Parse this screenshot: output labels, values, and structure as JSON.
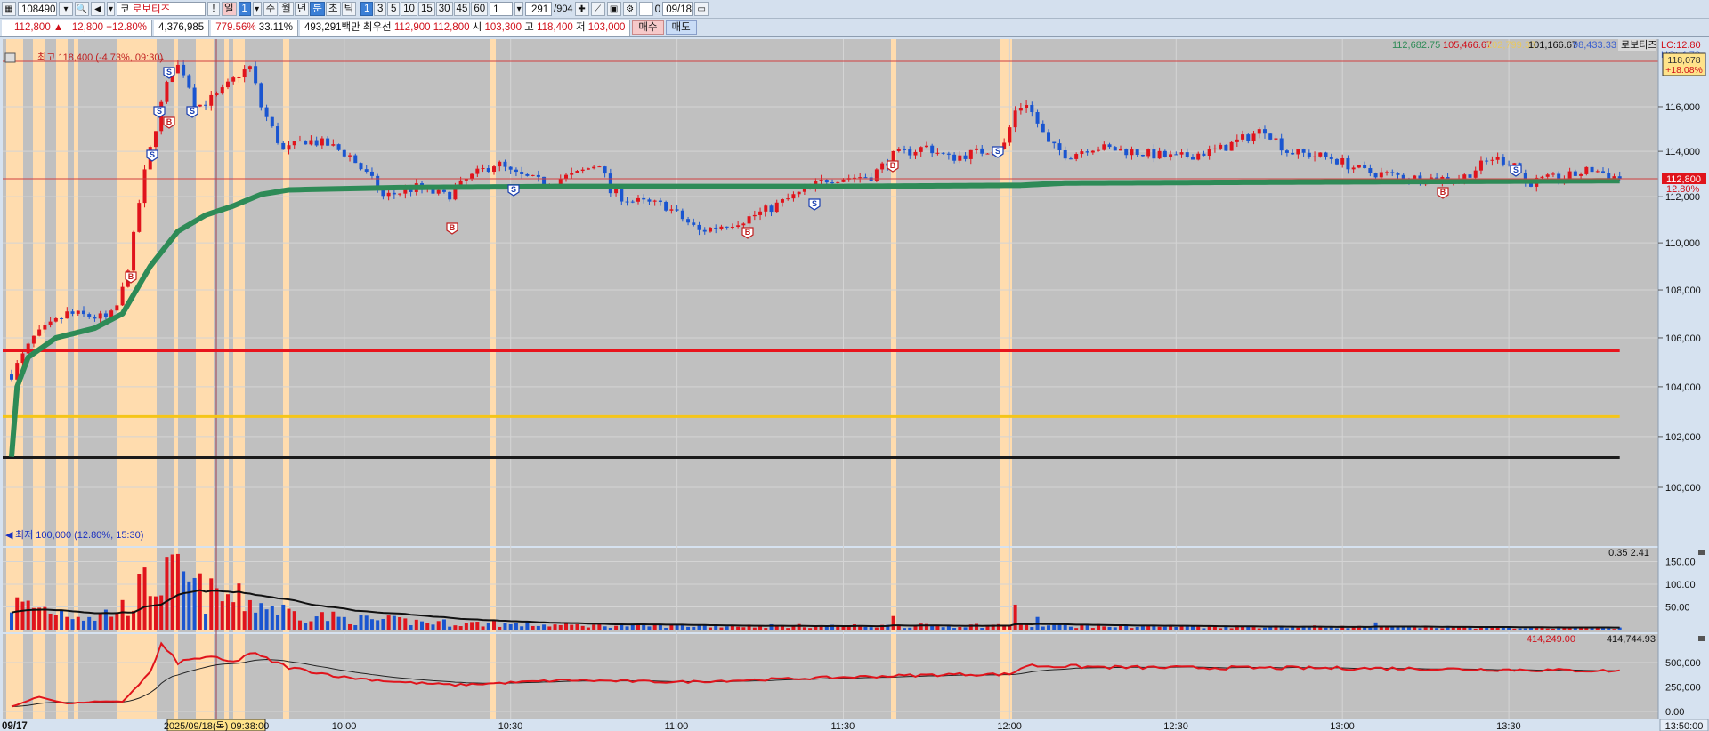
{
  "toolbar": {
    "code": "108490",
    "market_label": "코",
    "stock_name": "로보티즈",
    "alert_label": "!",
    "day_label": "일",
    "day_count": "1",
    "periods": [
      "주",
      "월",
      "년",
      "분",
      "초",
      "틱"
    ],
    "selected_period": "분",
    "intervals": [
      "1",
      "3",
      "5",
      "10",
      "15",
      "30",
      "45",
      "60"
    ],
    "selected_interval": "1",
    "multiplier": "1",
    "count": "291",
    "total": "/904",
    "checkbox_value": "0",
    "date": "09/18"
  },
  "quote": {
    "price": "112,800 ▲",
    "change": "12,800",
    "change_pct": "+12.80%",
    "volume": "4,376,985",
    "volume_ratio": "779.56%",
    "turnover": "33.11%",
    "amount": "493,291백만",
    "best_label": "최우선",
    "best_ask": "112,900",
    "best_bid": "112,800",
    "open_label": "시",
    "open": "103,300",
    "high_label": "고",
    "high": "118,400",
    "low_label": "저",
    "low": "103,000",
    "buy_button": "매수",
    "sell_button": "매도"
  },
  "chart": {
    "high_note": "최고 118,400 (-4.73%, 09:30)",
    "low_note": "최저 100,000 (12.80%, 15:30)",
    "legend": {
      "vwap": "112,682.75",
      "red_line": "105,466.67",
      "yellow_line": "102,799.33",
      "black_line": "101,166.67",
      "blue_line": "98,433.33",
      "name": "로보티즈"
    },
    "lc": "LC:12.80",
    "hc": "HC:-4.73",
    "cursor_price": "118,078",
    "cursor_pct": "+18.08%",
    "last_price": "112,800",
    "last_pct": "12.80%",
    "price_ticks": [
      "116,000",
      "114,000",
      "112,000",
      "110,000",
      "108,000",
      "106,000",
      "104,000",
      "102,000",
      "100,000"
    ],
    "volume_legend": "0.35 2.41",
    "volume_ticks": [
      "150.00",
      "100.00",
      "50.00"
    ],
    "indicator_legend_red": "414,249.00",
    "indicator_legend_black": "414,744.93",
    "indicator_ticks": [
      "500,000",
      "250,000",
      "0.00"
    ],
    "time_ticks": [
      "10:00",
      "10:30",
      "11:00",
      "11:30",
      "12:00",
      "12:30",
      "13:00",
      "13:30"
    ],
    "start_date": "09/17",
    "cursor_time": "2025/09/18(목) 09:38:00",
    "end_time": "13:50:00",
    "buy_marker": "B",
    "sell_marker": "S",
    "colors": {
      "up": "#e0141c",
      "down": "#1a55d0",
      "vwap": "#2e8b57",
      "red_line": "#e8141c",
      "yellow_line": "#f5c518",
      "black_line": "#1a1a1a",
      "highlight": "#ffdcae",
      "pane": "#c0c0c0"
    }
  },
  "chart_data": {
    "type": "candlestick",
    "x_unit": "minutes since 09:00",
    "price_path": [
      [
        0,
        104500
      ],
      [
        4,
        106000
      ],
      [
        10,
        107000
      ],
      [
        17.6,
        106800
      ],
      [
        19.5,
        107500
      ],
      [
        21.5,
        109500
      ],
      [
        23.5,
        112500
      ],
      [
        25.4,
        114500
      ],
      [
        27.4,
        116500
      ],
      [
        29.4,
        118000
      ],
      [
        31.3,
        117500
      ],
      [
        33.3,
        116000
      ],
      [
        37.2,
        116500
      ],
      [
        41.1,
        117500
      ],
      [
        43.1,
        117800
      ],
      [
        45,
        116000
      ],
      [
        49,
        114000
      ],
      [
        53,
        114500
      ],
      [
        57,
        114300
      ],
      [
        61,
        113800
      ],
      [
        65,
        112700
      ],
      [
        67,
        112000
      ],
      [
        73,
        112400
      ],
      [
        78.5,
        112000
      ],
      [
        82.4,
        112800
      ],
      [
        87.4,
        113500
      ],
      [
        90.3,
        113000
      ],
      [
        96,
        112600
      ],
      [
        102,
        113000
      ],
      [
        106,
        113500
      ],
      [
        108,
        112200
      ],
      [
        112,
        111800
      ],
      [
        118,
        111600
      ],
      [
        124,
        110500
      ],
      [
        132,
        111000
      ],
      [
        136,
        111400
      ],
      [
        143.4,
        112300
      ],
      [
        147.3,
        112800
      ],
      [
        155,
        112900
      ],
      [
        159,
        113800
      ],
      [
        165,
        114200
      ],
      [
        169,
        113700
      ],
      [
        175,
        114000
      ],
      [
        179,
        114300
      ],
      [
        181,
        115800
      ],
      [
        183,
        116200
      ],
      [
        187,
        114300
      ],
      [
        190.6,
        113800
      ],
      [
        194.5,
        114200
      ],
      [
        202,
        114000
      ],
      [
        210,
        113700
      ],
      [
        218,
        114100
      ],
      [
        226,
        115000
      ],
      [
        230,
        114000
      ],
      [
        238,
        113700
      ],
      [
        244,
        113100
      ],
      [
        253.5,
        112800
      ],
      [
        261.4,
        112800
      ],
      [
        267,
        113700
      ],
      [
        271,
        113500
      ],
      [
        273,
        112600
      ],
      [
        281,
        112900
      ],
      [
        285,
        113200
      ],
      [
        290,
        112800
      ]
    ],
    "vwap_path": [
      [
        0,
        101200
      ],
      [
        1,
        104000
      ],
      [
        3,
        105200
      ],
      [
        8,
        106000
      ],
      [
        15,
        106400
      ],
      [
        20,
        107000
      ],
      [
        25,
        109000
      ],
      [
        30,
        110500
      ],
      [
        35,
        111200
      ],
      [
        40,
        111600
      ],
      [
        45,
        112100
      ],
      [
        50,
        112300
      ],
      [
        70,
        112400
      ],
      [
        100,
        112450
      ],
      [
        150,
        112450
      ],
      [
        182,
        112500
      ],
      [
        190,
        112600
      ],
      [
        290,
        112700
      ]
    ],
    "levels": {
      "red": 105466.67,
      "yellow": 102799.33,
      "black": 101166.67
    },
    "volume_path": [
      [
        0,
        60
      ],
      [
        5,
        50
      ],
      [
        10,
        40
      ],
      [
        15,
        30
      ],
      [
        20,
        50
      ],
      [
        25,
        110
      ],
      [
        30,
        120
      ],
      [
        35,
        80
      ],
      [
        40,
        70
      ],
      [
        45,
        60
      ],
      [
        50,
        40
      ],
      [
        60,
        25
      ],
      [
        80,
        15
      ],
      [
        100,
        10
      ],
      [
        150,
        8
      ],
      [
        180,
        10
      ],
      [
        200,
        8
      ],
      [
        290,
        4
      ]
    ],
    "volume_spikes": [
      [
        87,
        22
      ],
      [
        159,
        30
      ],
      [
        181,
        55
      ],
      [
        185,
        28
      ],
      [
        246,
        16
      ]
    ],
    "indicator_path": [
      [
        0,
        50000
      ],
      [
        5,
        150000
      ],
      [
        10,
        80000
      ],
      [
        15,
        100000
      ],
      [
        20,
        100000
      ],
      [
        25,
        400000
      ],
      [
        27,
        680000
      ],
      [
        30,
        500000
      ],
      [
        35,
        560000
      ],
      [
        40,
        500000
      ],
      [
        43,
        600000
      ],
      [
        50,
        450000
      ],
      [
        60,
        350000
      ],
      [
        70,
        300000
      ],
      [
        80,
        270000
      ],
      [
        100,
        320000
      ],
      [
        120,
        300000
      ],
      [
        150,
        350000
      ],
      [
        170,
        380000
      ],
      [
        180,
        380000
      ],
      [
        183,
        470000
      ],
      [
        200,
        450000
      ],
      [
        250,
        440000
      ],
      [
        290,
        414249
      ]
    ]
  }
}
